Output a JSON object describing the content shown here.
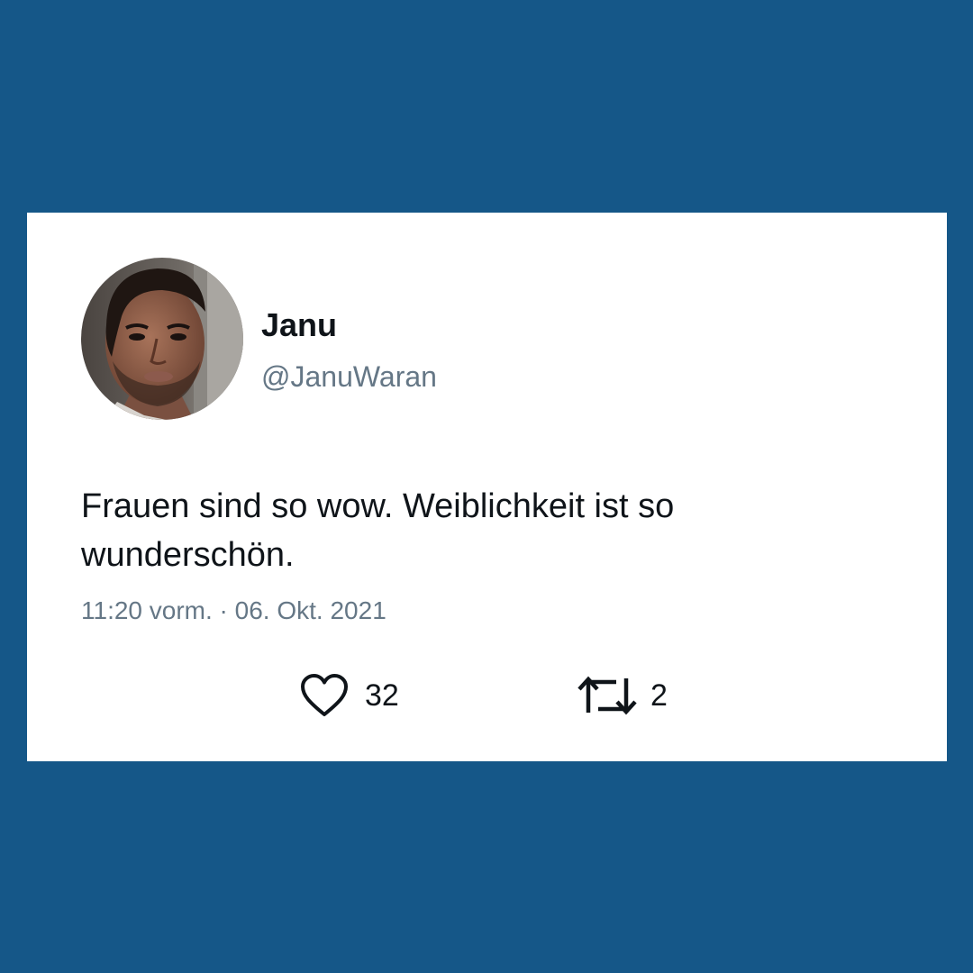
{
  "tweet": {
    "author": {
      "display_name": "Janu",
      "handle": "@JanuWaran",
      "avatar_icon": "profile-photo"
    },
    "text": "Frauen sind so wow. Weiblichkeit ist so wunderschön.",
    "timestamp": "11:20 vorm. · 06. Okt. 2021",
    "likes": {
      "icon": "heart-icon",
      "count": "32"
    },
    "retweets": {
      "icon": "retweet-icon",
      "count": "2"
    }
  },
  "colors": {
    "background": "#155788",
    "card": "#ffffff",
    "text_primary": "#0f1419",
    "text_secondary": "#657786"
  }
}
